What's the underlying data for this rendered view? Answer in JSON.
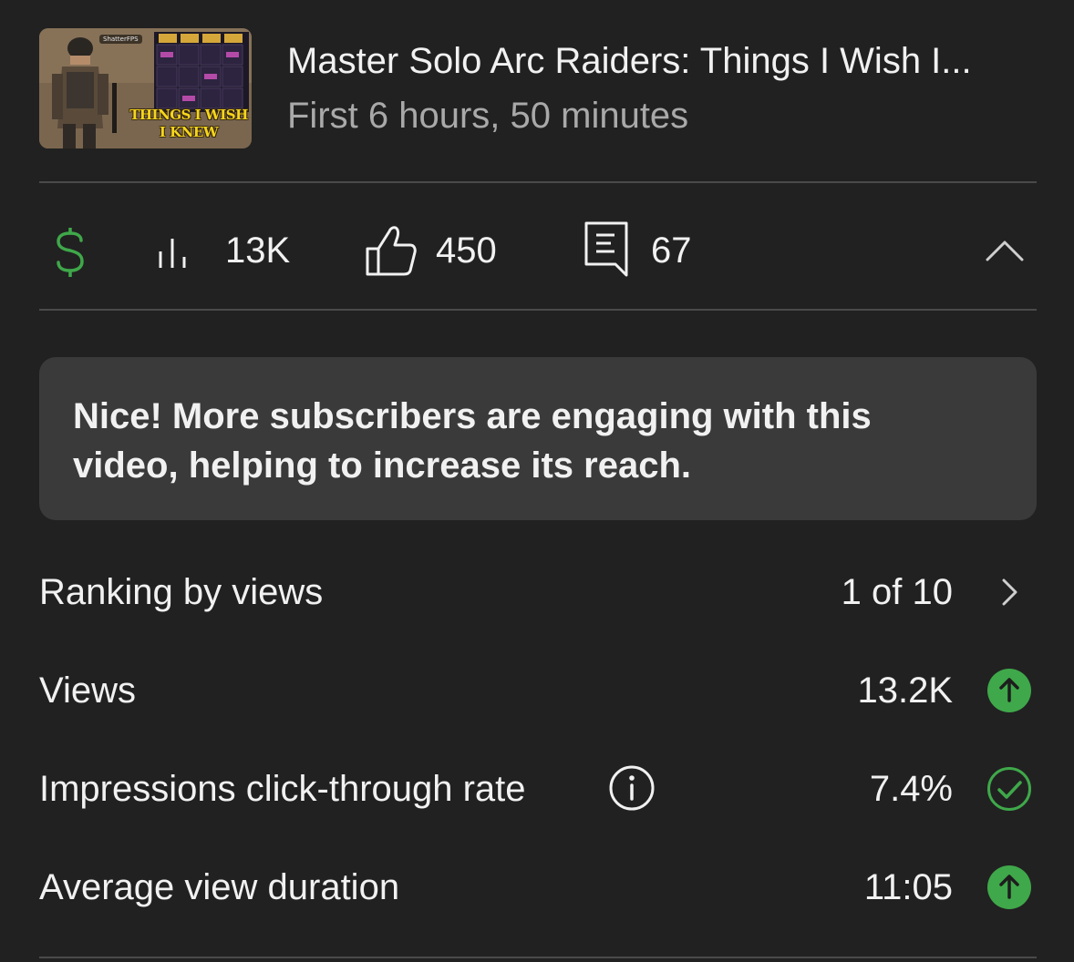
{
  "video": {
    "title": "Master Solo Arc Raiders: Things I Wish I...",
    "period": "First 6 hours, 50 minutes",
    "thumbnail": {
      "caption_line1": "THINGS I WISH",
      "caption_line2": "I KNEW",
      "channel_badge": "ShatterFPS"
    }
  },
  "stats": {
    "monetization_icon": "dollar-icon",
    "views_icon": "bar-chart-icon",
    "views": "13K",
    "likes_icon": "thumbs-up-icon",
    "likes": "450",
    "comments_icon": "comment-icon",
    "comments": "67",
    "collapse_icon": "chevron-up-icon"
  },
  "banner": {
    "text": "Nice! More subscribers are engaging with this video, helping to increase its reach."
  },
  "metrics": [
    {
      "label": "Ranking by views",
      "value": "1 of 10",
      "icon": "chevron-right-icon"
    },
    {
      "label": "Views",
      "value": "13.2K",
      "icon": "arrow-up-circle-icon"
    },
    {
      "label": "Impressions click-through rate",
      "value": "7.4%",
      "icon": "check-circle-icon",
      "info_icon": "info-icon"
    },
    {
      "label": "Average view duration",
      "value": "11:05",
      "icon": "arrow-up-circle-icon"
    }
  ],
  "colors": {
    "background": "#212121",
    "banner": "#3a3a3a",
    "accent_green": "#3fa84a",
    "muted_text": "#a9a9a9"
  }
}
